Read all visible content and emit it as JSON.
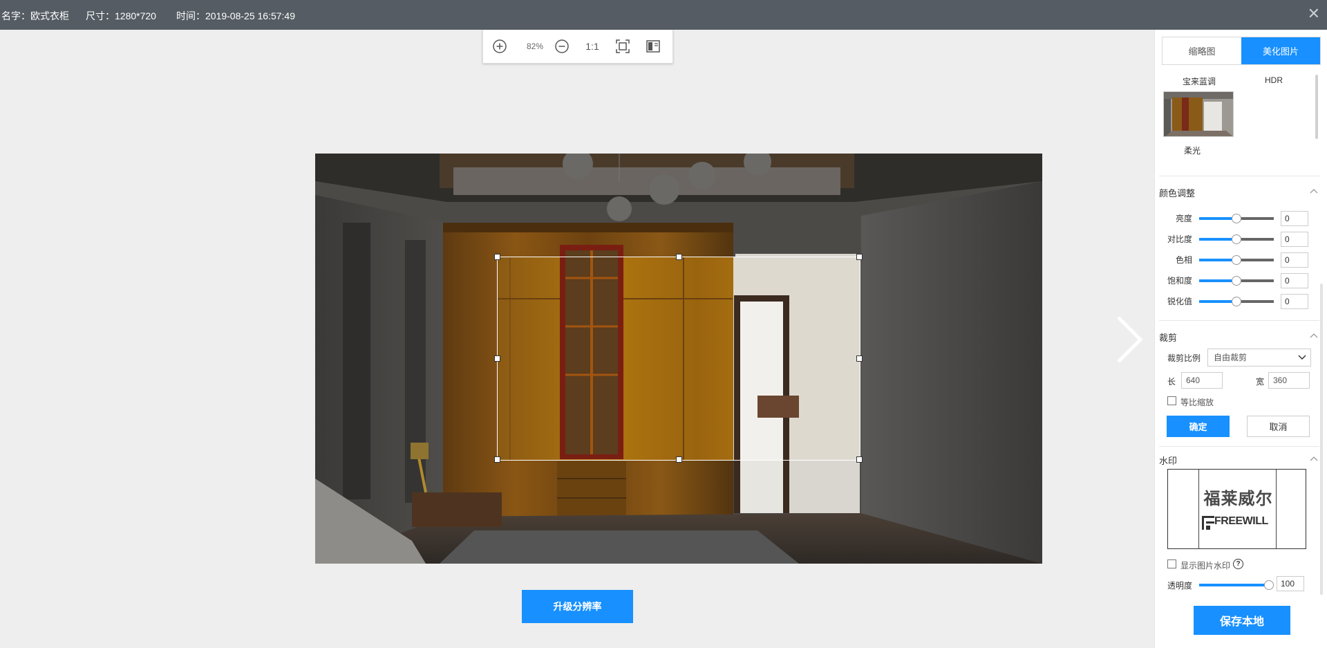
{
  "header": {
    "name_label": "名字：欧式衣柜",
    "size_label": "尺寸：1280*720",
    "time_label": "时间：2019-08-25 16:57:49",
    "close_glyph": "✕"
  },
  "zoom_toolbar": {
    "zoom_level": "82%",
    "actual_size": "1:1"
  },
  "upgrade_button": "升级分辨率",
  "panel": {
    "tabs": [
      {
        "label": "缩略图",
        "active": false
      },
      {
        "label": "美化图片",
        "active": true
      }
    ],
    "filters": {
      "items": [
        "宝来蓝调",
        "HDR",
        "柔光"
      ]
    },
    "color_adjust": {
      "title": "颜色调整",
      "rows": [
        {
          "label": "亮度",
          "value": "0",
          "level": 0.5
        },
        {
          "label": "对比度",
          "value": "0",
          "level": 0.5
        },
        {
          "label": "色相",
          "value": "0",
          "level": 0.5
        },
        {
          "label": "饱和度",
          "value": "0",
          "level": 0.5
        },
        {
          "label": "锐化值",
          "value": "0",
          "level": 0.5
        }
      ]
    },
    "crop": {
      "title": "裁剪",
      "ratio_label": "裁剪比例",
      "ratio_value": "自由裁剪",
      "length_label": "长",
      "length_value": "640",
      "width_label": "宽",
      "width_value": "360",
      "proportional_label": "等比缩放",
      "proportional_checked": false,
      "confirm_label": "确定",
      "cancel_label": "取消"
    },
    "watermark": {
      "title": "水印",
      "logo_cn": "福莱威尔",
      "logo_en": "FREEWILL",
      "show_label": "显示图片水印",
      "show_checked": false,
      "help_glyph": "?",
      "opacity_label": "透明度",
      "opacity_value": "100",
      "opacity_level": 1.0
    },
    "save_label": "保存本地"
  },
  "colors": {
    "accent": "#1890ff",
    "header_bg": "#555c63"
  }
}
